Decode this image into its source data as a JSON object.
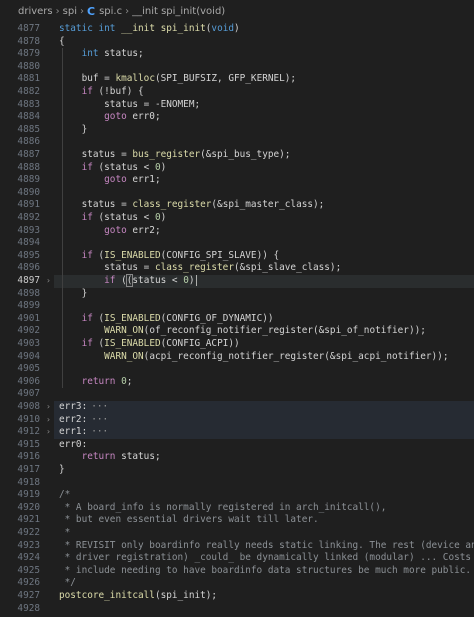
{
  "breadcrumb": [
    "drivers",
    "spi",
    "spi.c",
    "__init spi_init(void)"
  ],
  "active_line": "4897",
  "lines": [
    {
      "n": "4877",
      "fold": "",
      "tokens": [
        [
          "kw",
          "static int "
        ],
        [
          "id",
          "__init "
        ],
        [
          "fn",
          "spi_init"
        ],
        [
          "",
          "("
        ],
        [
          "kw",
          "void"
        ],
        [
          "",
          ")"
        ]
      ]
    },
    {
      "n": "4878",
      "fold": "",
      "tokens": [
        [
          "",
          "{"
        ]
      ]
    },
    {
      "n": "4879",
      "fold": "",
      "tokens": [
        [
          "",
          "    "
        ],
        [
          "kw",
          "int"
        ],
        [
          "",
          " status;"
        ]
      ]
    },
    {
      "n": "4880",
      "fold": "",
      "tokens": []
    },
    {
      "n": "4881",
      "fold": "",
      "tokens": [
        [
          "",
          "    buf = "
        ],
        [
          "fn",
          "kmalloc"
        ],
        [
          "",
          "(SPI_BUFSIZ, GFP_KERNEL);"
        ]
      ]
    },
    {
      "n": "4882",
      "fold": "",
      "tokens": [
        [
          "",
          "    "
        ],
        [
          "ctl",
          "if"
        ],
        [
          "",
          " (!buf) {"
        ]
      ]
    },
    {
      "n": "4883",
      "fold": "",
      "tokens": [
        [
          "",
          "        status = -ENOMEM;"
        ]
      ]
    },
    {
      "n": "4884",
      "fold": "",
      "tokens": [
        [
          "",
          "        "
        ],
        [
          "ctl",
          "goto"
        ],
        [
          "",
          " err0;"
        ]
      ]
    },
    {
      "n": "4885",
      "fold": "",
      "tokens": [
        [
          "",
          "    }"
        ]
      ]
    },
    {
      "n": "4886",
      "fold": "",
      "tokens": []
    },
    {
      "n": "4887",
      "fold": "",
      "tokens": [
        [
          "",
          "    status = "
        ],
        [
          "fn",
          "bus_register"
        ],
        [
          "",
          "(&spi_bus_type);"
        ]
      ]
    },
    {
      "n": "4888",
      "fold": "",
      "tokens": [
        [
          "",
          "    "
        ],
        [
          "ctl",
          "if"
        ],
        [
          "",
          " (status < "
        ],
        [
          "num",
          "0"
        ],
        [
          "",
          ")"
        ]
      ]
    },
    {
      "n": "4889",
      "fold": "",
      "tokens": [
        [
          "",
          "        "
        ],
        [
          "ctl",
          "goto"
        ],
        [
          "",
          " err1;"
        ]
      ]
    },
    {
      "n": "4890",
      "fold": "",
      "tokens": []
    },
    {
      "n": "4891",
      "fold": "",
      "tokens": [
        [
          "",
          "    status = "
        ],
        [
          "fn",
          "class_register"
        ],
        [
          "",
          "(&spi_master_class);"
        ]
      ]
    },
    {
      "n": "4892",
      "fold": "",
      "tokens": [
        [
          "",
          "    "
        ],
        [
          "ctl",
          "if"
        ],
        [
          "",
          " (status < "
        ],
        [
          "num",
          "0"
        ],
        [
          "",
          ")"
        ]
      ]
    },
    {
      "n": "4893",
      "fold": "",
      "tokens": [
        [
          "",
          "        "
        ],
        [
          "ctl",
          "goto"
        ],
        [
          "",
          " err2;"
        ]
      ]
    },
    {
      "n": "4894",
      "fold": "",
      "tokens": []
    },
    {
      "n": "4895",
      "fold": "",
      "tokens": [
        [
          "",
          "    "
        ],
        [
          "ctl",
          "if"
        ],
        [
          "",
          " ("
        ],
        [
          "fn",
          "IS_ENABLED"
        ],
        [
          "",
          "(CONFIG_SPI_SLAVE)) {"
        ]
      ]
    },
    {
      "n": "4896",
      "fold": "",
      "tokens": [
        [
          "",
          "        status = "
        ],
        [
          "fn",
          "class_register"
        ],
        [
          "",
          "(&spi_slave_class);"
        ]
      ]
    },
    {
      "n": "4897",
      "fold": "›",
      "tokens": [
        [
          "",
          "        "
        ],
        [
          "ctl",
          "if"
        ],
        [
          "",
          " ("
        ],
        [
          "box",
          "(status < "
        ],
        [
          "num",
          "0"
        ],
        [
          "",
          ")"
        ]
      ]
    },
    {
      "n": "4898",
      "fold": "",
      "tokens": [
        [
          "",
          "    }"
        ]
      ]
    },
    {
      "n": "4899",
      "fold": "",
      "tokens": []
    },
    {
      "n": "4901",
      "fold": "",
      "tokens": [
        [
          "",
          "    "
        ],
        [
          "ctl",
          "if"
        ],
        [
          "",
          " ("
        ],
        [
          "fn",
          "IS_ENABLED"
        ],
        [
          "",
          "(CONFIG_OF_DYNAMIC))"
        ]
      ]
    },
    {
      "n": "4902",
      "fold": "",
      "tokens": [
        [
          "",
          "        "
        ],
        [
          "fn",
          "WARN_ON"
        ],
        [
          "",
          "(of_reconfig_notifier_register(&spi_of_notifier));"
        ]
      ]
    },
    {
      "n": "4903",
      "fold": "",
      "tokens": [
        [
          "",
          "    "
        ],
        [
          "ctl",
          "if"
        ],
        [
          "",
          " ("
        ],
        [
          "fn",
          "IS_ENABLED"
        ],
        [
          "",
          "(CONFIG_ACPI))"
        ]
      ]
    },
    {
      "n": "4904",
      "fold": "",
      "tokens": [
        [
          "",
          "        "
        ],
        [
          "fn",
          "WARN_ON"
        ],
        [
          "",
          "(acpi_reconfig_notifier_register(&spi_acpi_notifier));"
        ]
      ]
    },
    {
      "n": "4905",
      "fold": "",
      "tokens": []
    },
    {
      "n": "4906",
      "fold": "",
      "tokens": [
        [
          "",
          "    "
        ],
        [
          "ctl",
          "return"
        ],
        [
          "",
          " "
        ],
        [
          "num",
          "0"
        ],
        [
          "",
          ";"
        ]
      ]
    },
    {
      "n": "4907",
      "fold": "",
      "tokens": []
    },
    {
      "n": "4908",
      "fold": "›",
      "folded": true,
      "tokens": [
        [
          "",
          "err3:"
        ],
        [
          "ellip",
          "···"
        ]
      ]
    },
    {
      "n": "4910",
      "fold": "›",
      "folded": true,
      "tokens": [
        [
          "",
          "err2:"
        ],
        [
          "ellip",
          "···"
        ]
      ]
    },
    {
      "n": "4912",
      "fold": "›",
      "folded": true,
      "tokens": [
        [
          "",
          "err1:"
        ],
        [
          "ellip",
          "···"
        ]
      ]
    },
    {
      "n": "4915",
      "fold": "",
      "tokens": [
        [
          "",
          "err0:"
        ]
      ]
    },
    {
      "n": "4916",
      "fold": "",
      "tokens": [
        [
          "",
          "    "
        ],
        [
          "ctl",
          "return"
        ],
        [
          "",
          " status;"
        ]
      ]
    },
    {
      "n": "4917",
      "fold": "",
      "tokens": [
        [
          "",
          "}"
        ]
      ]
    },
    {
      "n": "4918",
      "fold": "",
      "tokens": []
    },
    {
      "n": "4919",
      "fold": "",
      "tokens": [
        [
          "cm",
          "/*"
        ]
      ]
    },
    {
      "n": "4920",
      "fold": "",
      "tokens": [
        [
          "cm",
          " * A board_info is normally registered in arch_initcall(),"
        ]
      ]
    },
    {
      "n": "4921",
      "fold": "",
      "tokens": [
        [
          "cm",
          " * but even essential drivers wait till later."
        ]
      ]
    },
    {
      "n": "4922",
      "fold": "",
      "tokens": [
        [
          "cm",
          " *"
        ]
      ]
    },
    {
      "n": "4923",
      "fold": "",
      "tokens": [
        [
          "cm",
          " * REVISIT only boardinfo really needs static linking. The rest (device and"
        ]
      ]
    },
    {
      "n": "4924",
      "fold": "",
      "tokens": [
        [
          "cm",
          " * driver registration) _could_ be dynamically linked (modular) ... Costs"
        ]
      ]
    },
    {
      "n": "4925",
      "fold": "",
      "tokens": [
        [
          "cm",
          " * include needing to have boardinfo data structures be much more public."
        ]
      ]
    },
    {
      "n": "4926",
      "fold": "",
      "tokens": [
        [
          "cm",
          " */"
        ]
      ]
    },
    {
      "n": "4927",
      "fold": "",
      "tokens": [
        [
          "fn",
          "postcore_initcall"
        ],
        [
          "",
          "(spi_init);"
        ]
      ]
    },
    {
      "n": "4928",
      "fold": "",
      "tokens": []
    }
  ]
}
